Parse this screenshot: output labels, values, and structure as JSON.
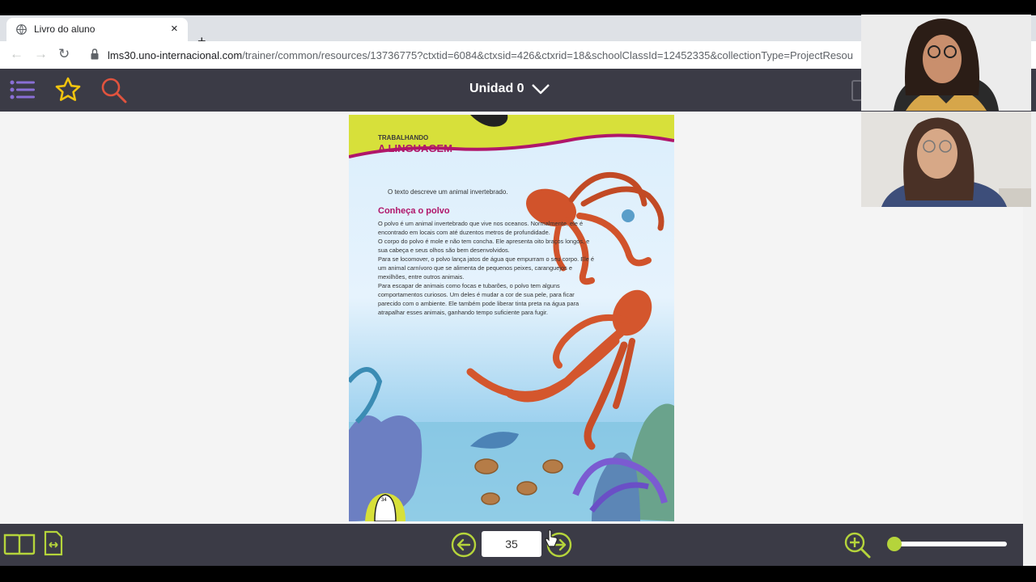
{
  "browser": {
    "tab_title": "Livro do aluno",
    "tab_close": "×",
    "new_tab": "+",
    "url_host": "lms30.uno-internacional.com",
    "url_path": "/trainer/common/resources/13736775?ctxtid=6084&ctxsid=426&ctxrid=18&schoolClassId=12452335&collectionType=ProjectResou"
  },
  "app": {
    "unit_title": "Unidad 0",
    "menu_icon": "menu-icon",
    "star_icon": "star-icon",
    "search_icon": "search-icon"
  },
  "page": {
    "header_small": "TRABALHANDO",
    "header_big": "A LINGUAGEM",
    "intro": "O texto descreve um animal invertebrado.",
    "subtitle": "Conheça o polvo",
    "paragraphs": [
      "O polvo é um animal invertebrado que vive nos oceanos. Normalmente, ele é encontrado em locais com até duzentos metros de profundidade.",
      "O corpo do polvo é mole e não tem concha. Ele apresenta oito braços longos, e sua cabeça e seus olhos são bem desenvolvidos.",
      "Para se locomover, o polvo lança jatos de água que empurram o seu corpo. Ele é um animal carnívoro que se alimenta de pequenos peixes, caranguejos e mexilhões, entre outros animais.",
      "Para escapar de animais como focas e tubarões, o polvo tem alguns comportamentos curiosos. Um deles é mudar a cor de sua pele, para ficar parecido com o ambiente. Ele também pode liberar tinta preta na água para atrapalhar esses animais, ganhando tempo suficiente para fugir."
    ],
    "printed_page_number": "34"
  },
  "footer": {
    "page_number": "35",
    "zoom_level": 0.05
  },
  "colors": {
    "app_bar": "#3b3b46",
    "accent_green": "#b5d43b",
    "accent_magenta": "#b0166a",
    "search_red": "#e0533e",
    "menu_purple": "#8a6fd6",
    "star_yellow": "#f1c40f"
  }
}
